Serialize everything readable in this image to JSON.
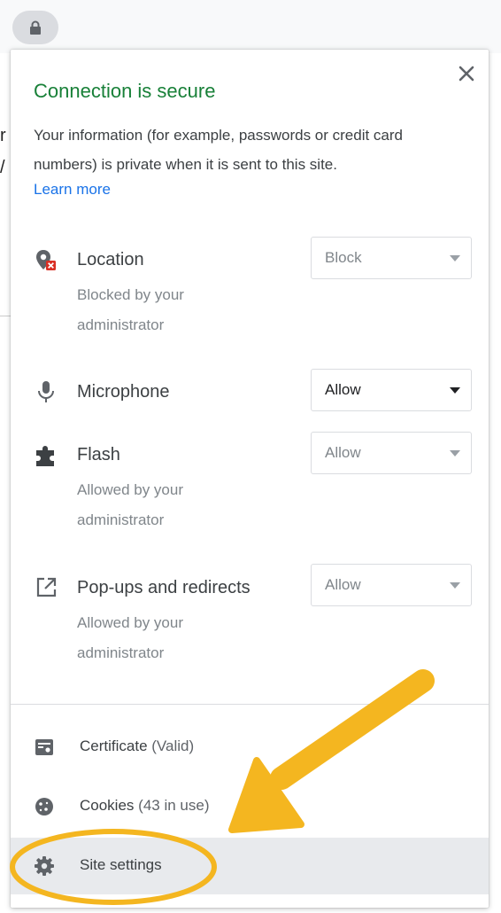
{
  "popup": {
    "title": "Connection is secure",
    "description": "Your information (for example, passwords or credit card numbers) is private when it is sent to this site.",
    "learn_more": "Learn more"
  },
  "permissions": [
    {
      "label": "Location",
      "value": "Block",
      "note_line1": "Blocked by your",
      "note_line2": "administrator",
      "icon": "location-blocked-icon"
    },
    {
      "label": "Microphone",
      "value": "Allow",
      "icon": "microphone-icon"
    },
    {
      "label": "Flash",
      "value": "Allow",
      "note_line1": "Allowed by your",
      "note_line2": "administrator",
      "icon": "puzzle-icon"
    },
    {
      "label": "Pop-ups and redirects",
      "value": "Allow",
      "note_line1": "Allowed by your",
      "note_line2": "administrator",
      "icon": "open-in-new-icon"
    }
  ],
  "menu": {
    "certificate": {
      "label": "Certificate",
      "status": "(Valid)",
      "icon": "certificate-icon"
    },
    "cookies": {
      "label": "Cookies",
      "status": "(43 in use)",
      "icon": "cookie-icon"
    },
    "site_settings": {
      "label": "Site settings",
      "icon": "gear-icon"
    }
  },
  "background_fragments": [
    "r",
    "/"
  ],
  "colors": {
    "secure_green": "#188038",
    "link_blue": "#1a73e8",
    "annotation_yellow": "#f4b620",
    "hover_gray": "#e8eaed"
  }
}
